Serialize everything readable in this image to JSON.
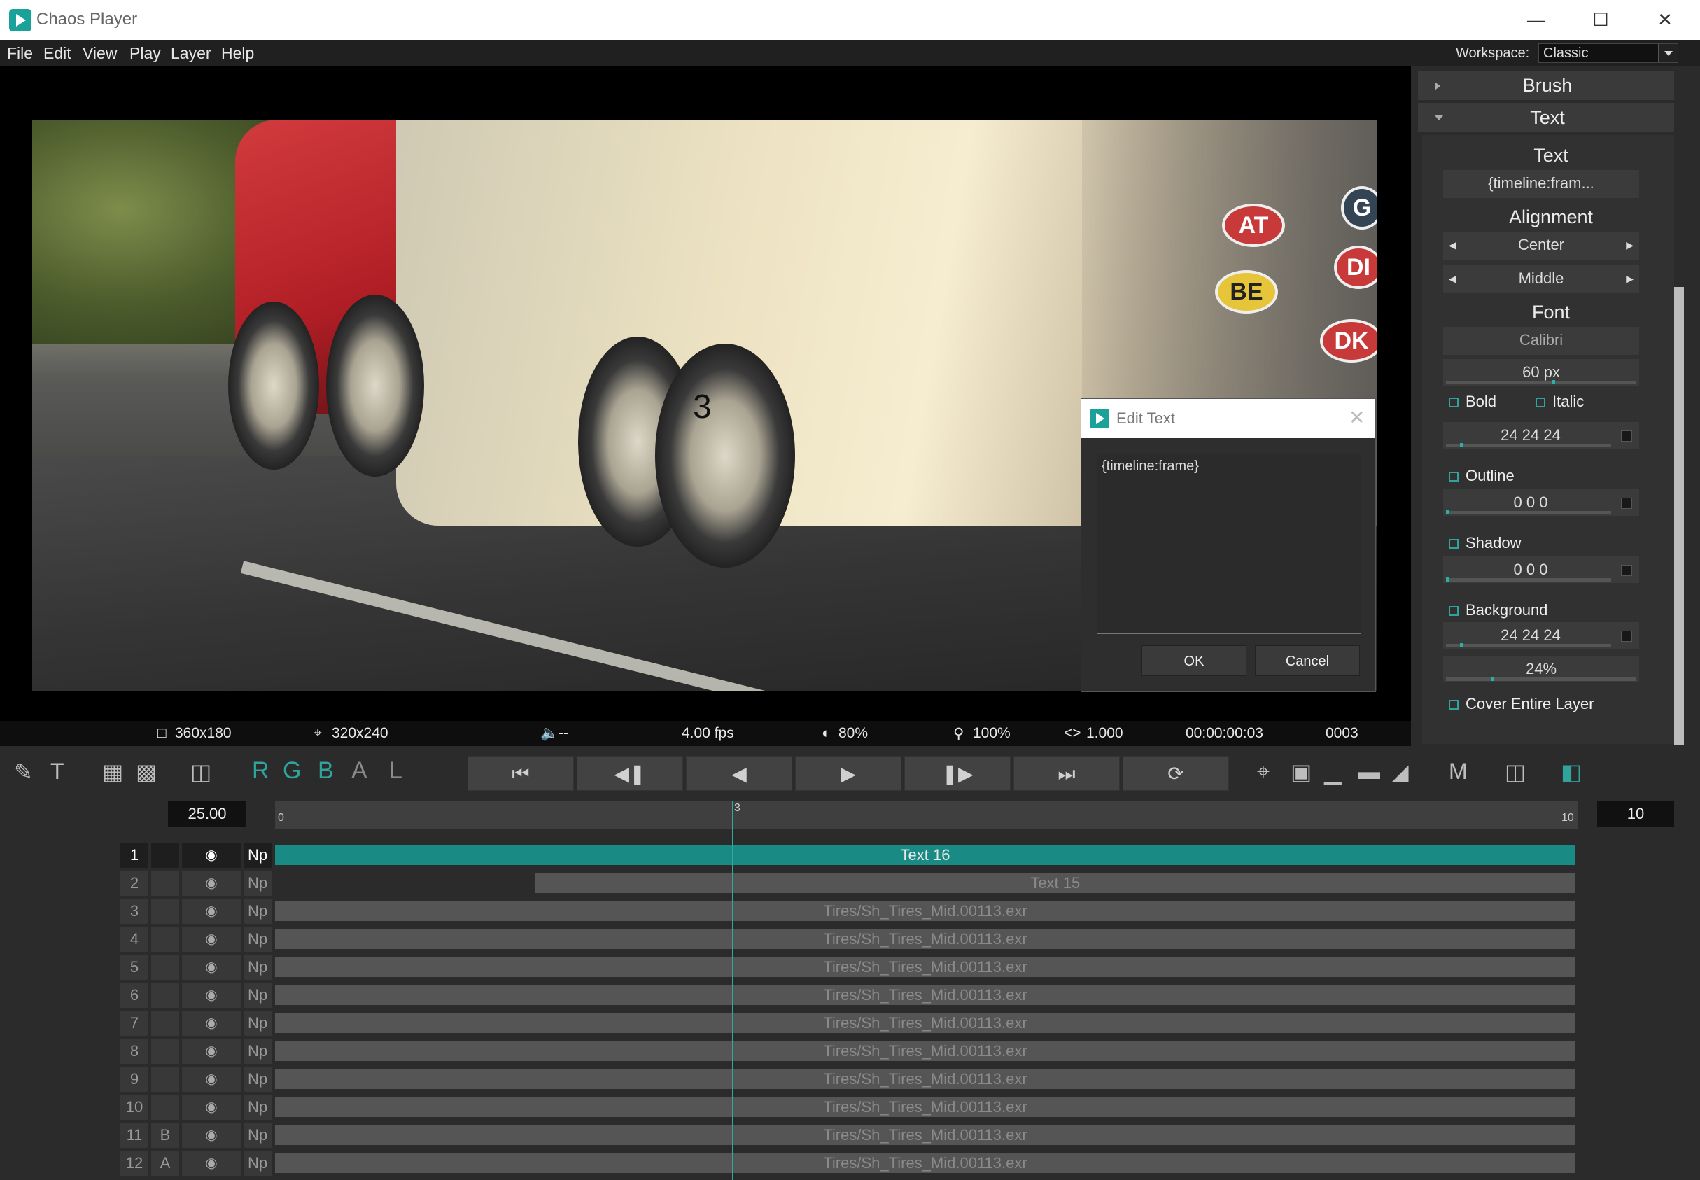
{
  "app": {
    "title": "Chaos Player"
  },
  "menu": [
    "File",
    "Edit",
    "View",
    "Play",
    "Layer",
    "Help"
  ],
  "workspace": {
    "label": "Workspace:",
    "value": "Classic"
  },
  "viewer": {
    "overlay_text": "3",
    "stickers": [
      "AT",
      "BE",
      "DK",
      "DI",
      "G"
    ]
  },
  "edit_dialog": {
    "title": "Edit Text",
    "value": "{timeline:frame}",
    "ok": "OK",
    "cancel": "Cancel"
  },
  "status": {
    "resolution": "360x180",
    "crop": "320x240",
    "audio": "--",
    "fps": "4.00 fps",
    "quality": "80%",
    "zoom": "100%",
    "ratio": "1.000",
    "timecode": "00:00:00:03",
    "frame": "0003"
  },
  "panel": {
    "brush": "Brush",
    "text_header": "Text",
    "text_label": "Text",
    "text_value": "{timeline:fram...",
    "alignment_label": "Alignment",
    "align_h": "Center",
    "align_v": "Middle",
    "font_label": "Font",
    "font_value": "Calibri",
    "font_size": "60 px",
    "bold": "Bold",
    "italic": "Italic",
    "text_color": "24 24 24",
    "outline": "Outline",
    "outline_color": "0 0 0",
    "shadow": "Shadow",
    "shadow_color": "0 0 0",
    "background": "Background",
    "background_color": "24 24 24",
    "background_opacity": "24%",
    "cover": "Cover Entire Layer"
  },
  "channels": [
    "R",
    "G",
    "B",
    "A",
    "L"
  ],
  "timeline": {
    "fps": "25.00",
    "start": "0",
    "current": "3",
    "end": "10",
    "end_field": "10"
  },
  "layers": [
    {
      "num": "1",
      "ab": "",
      "np": "Np",
      "name": "Text 16",
      "start": 0.0
    },
    {
      "num": "2",
      "ab": "",
      "np": "Np",
      "name": "Text 15",
      "start": 0.2
    },
    {
      "num": "3",
      "ab": "",
      "np": "Np",
      "name": "Tires/Sh_Tires_Mid.00113.exr",
      "start": 0.0
    },
    {
      "num": "4",
      "ab": "",
      "np": "Np",
      "name": "Tires/Sh_Tires_Mid.00113.exr",
      "start": 0.0
    },
    {
      "num": "5",
      "ab": "",
      "np": "Np",
      "name": "Tires/Sh_Tires_Mid.00113.exr",
      "start": 0.0
    },
    {
      "num": "6",
      "ab": "",
      "np": "Np",
      "name": "Tires/Sh_Tires_Mid.00113.exr",
      "start": 0.0
    },
    {
      "num": "7",
      "ab": "",
      "np": "Np",
      "name": "Tires/Sh_Tires_Mid.00113.exr",
      "start": 0.0
    },
    {
      "num": "8",
      "ab": "",
      "np": "Np",
      "name": "Tires/Sh_Tires_Mid.00113.exr",
      "start": 0.0
    },
    {
      "num": "9",
      "ab": "",
      "np": "Np",
      "name": "Tires/Sh_Tires_Mid.00113.exr",
      "start": 0.0
    },
    {
      "num": "10",
      "ab": "",
      "np": "Np",
      "name": "Tires/Sh_Tires_Mid.00113.exr",
      "start": 0.0
    },
    {
      "num": "11",
      "ab": "B",
      "np": "Np",
      "name": "Tires/Sh_Tires_Mid.00113.exr",
      "start": 0.0
    },
    {
      "num": "12",
      "ab": "A",
      "np": "Np",
      "name": "Tires/Sh_Tires_Mid.00113.exr",
      "start": 0.0
    }
  ],
  "colors": {
    "accent": "#2fa39c",
    "active_clip": "#1a8b84"
  }
}
